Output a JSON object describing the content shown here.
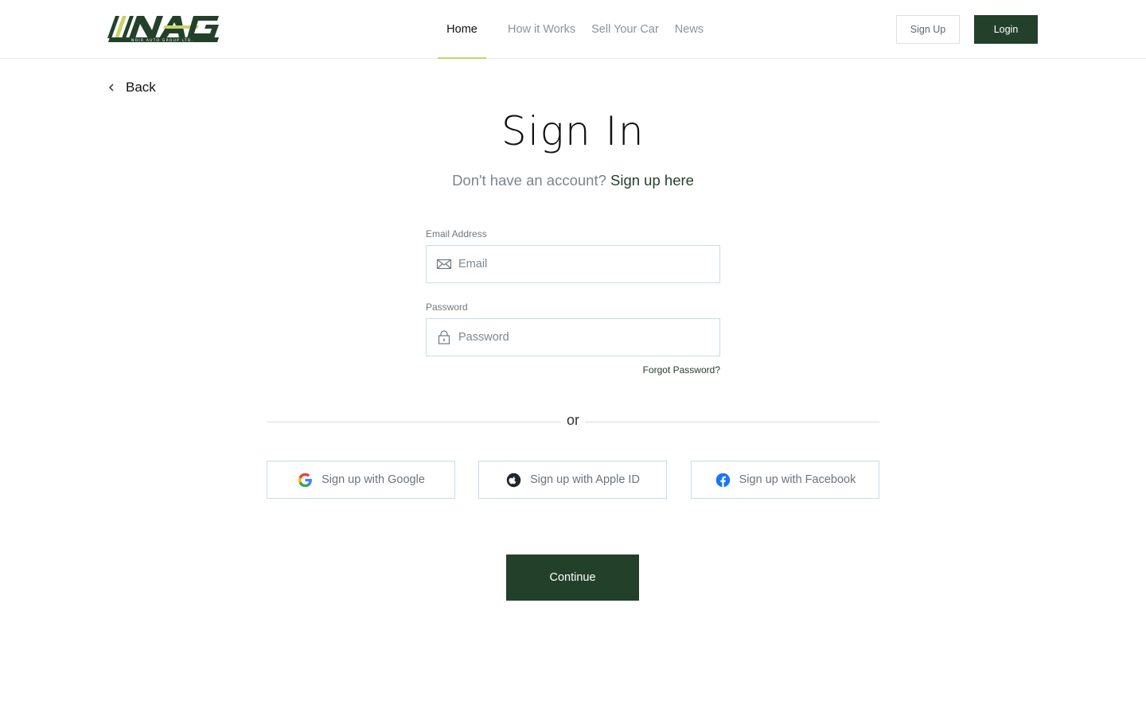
{
  "brand": {
    "logo_text": "NAG",
    "logo_tagline": "NOIR AUTO GROUP LTD.",
    "primary_color": "#23412a",
    "accent_color": "#c8d46a"
  },
  "nav": {
    "items": [
      {
        "label": "Home",
        "active": true
      },
      {
        "label": "How it Works",
        "active": false
      },
      {
        "label": "Sell Your Car",
        "active": false
      },
      {
        "label": "News",
        "active": false
      }
    ]
  },
  "header": {
    "signup_label": "Sign Up",
    "login_label": "Login"
  },
  "back": {
    "label": "Back",
    "icon": "chevron-left-icon"
  },
  "signin": {
    "title": "Sign In",
    "subtitle_text": "Don't have an account?",
    "subtitle_link": "Sign up here",
    "email": {
      "label": "Email Address",
      "placeholder": "Email",
      "value": "",
      "icon": "envelope-icon"
    },
    "password": {
      "label": "Password",
      "placeholder": "Password",
      "value": "",
      "icon": "lock-icon"
    },
    "forgot_label": "Forgot Password?",
    "divider": "or",
    "social": [
      {
        "label": "Sign up with Google",
        "icon": "google-icon"
      },
      {
        "label": "Sign up with Apple ID",
        "icon": "apple-icon"
      },
      {
        "label": "Sign up with Facebook",
        "icon": "facebook-icon"
      }
    ],
    "continue_label": "Continue"
  }
}
